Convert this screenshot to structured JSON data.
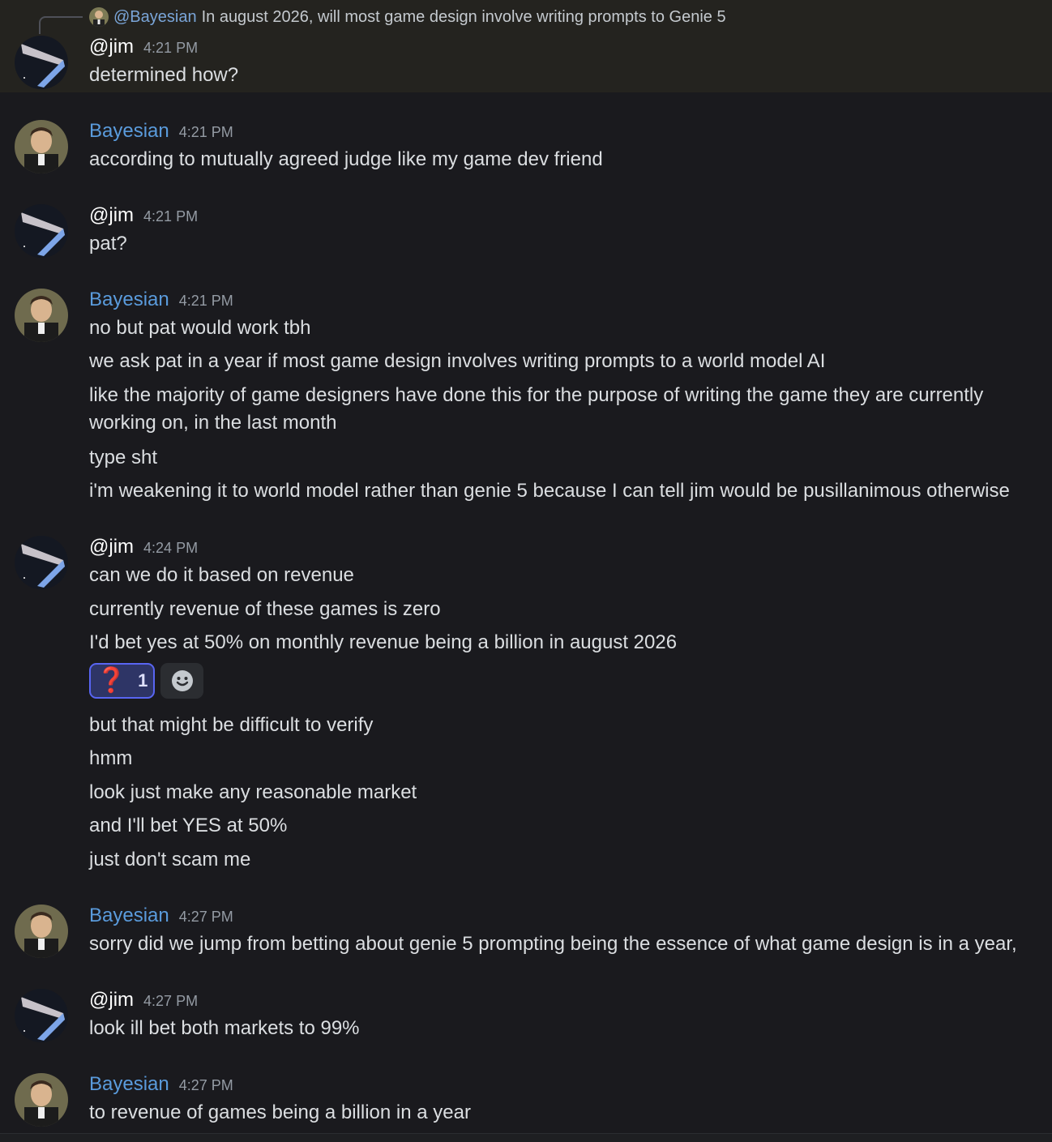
{
  "reply": {
    "mention": "@Bayesian",
    "text": "In august 2026, will most game design involve writing prompts to Genie 5"
  },
  "users": {
    "jim": {
      "name": "@jim",
      "avatar_icon": "space-streak-avatar"
    },
    "bayesian": {
      "name": "Bayesian",
      "avatar_icon": "portrait-avatar",
      "color": "#5a9bdc"
    }
  },
  "messages": [
    {
      "author": "@jim",
      "time": "4:21 PM",
      "lines": [
        "determined how?"
      ]
    },
    {
      "author": "Bayesian",
      "time": "4:21 PM",
      "lines": [
        "according to mutually agreed judge like my game dev friend"
      ]
    },
    {
      "author": "@jim",
      "time": "4:21 PM",
      "lines": [
        "pat?"
      ]
    },
    {
      "author": "Bayesian",
      "time": "4:21 PM",
      "lines": [
        "no but pat would work tbh",
        "we ask pat in a year if most game design involves writing prompts to a world model AI",
        "like the majority of game designers have done this for the purpose of writing the game they are currently working on, in the last month",
        "type sht",
        "i'm weakening it to world model rather than genie 5 because I can tell jim would be pusillanimous otherwise"
      ]
    },
    {
      "author": "@jim",
      "time": "4:24 PM",
      "lines": [
        "can we do it based on revenue",
        "currently revenue of these games is zero",
        "I'd bet yes at 50% on monthly revenue being a billion in august 2026",
        "but that might be difficult to verify",
        "hmm",
        "look just make any reasonable market",
        "and I'll bet YES at 50%",
        "just don't scam me"
      ]
    },
    {
      "author": "Bayesian",
      "time": "4:27 PM",
      "lines": [
        "sorry did we jump from betting about genie 5 prompting being the essence of what game design is in a year,"
      ]
    },
    {
      "author": "@jim",
      "time": "4:27 PM",
      "lines": [
        "look ill bet both markets to 99%"
      ]
    },
    {
      "author": "Bayesian",
      "time": "4:27 PM",
      "lines": [
        "to revenue of games being a billion in a year"
      ]
    }
  ],
  "reaction": {
    "emoji": "❓",
    "count": "1",
    "add_icon": "add-reaction-icon"
  }
}
